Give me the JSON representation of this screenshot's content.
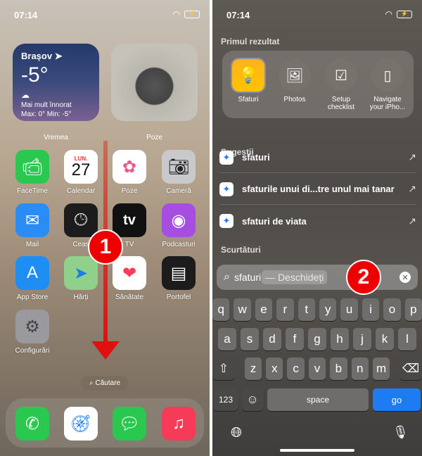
{
  "left": {
    "time": "07:14",
    "weather": {
      "city": "Brașov",
      "temp": "-5°",
      "condition": "Mai mult înnorat",
      "range": "Max: 0° Min: -5°",
      "label": "Vremea"
    },
    "photos_widget": {
      "label": "Poze"
    },
    "apps": [
      {
        "label": "FaceTime",
        "icon": "facetime-icon",
        "color": "#2ac84e"
      },
      {
        "label": "Calendar",
        "icon": "calendar-icon",
        "color": "#ffffff",
        "day": "LUN.",
        "date": "27"
      },
      {
        "label": "Poze",
        "icon": "photos-icon",
        "color": "#ffffff"
      },
      {
        "label": "Cameră",
        "icon": "camera-icon",
        "color": "#c9c9cc"
      },
      {
        "label": "Mail",
        "icon": "mail-icon",
        "color": "#2a8cf5"
      },
      {
        "label": "Ceas",
        "icon": "clock-icon",
        "color": "#1c1c1c"
      },
      {
        "label": "TV",
        "icon": "appletv-icon",
        "color": "#111111",
        "glyph": "tv"
      },
      {
        "label": "Podcasturi",
        "icon": "podcasts-icon",
        "color": "#a64ee0"
      },
      {
        "label": "App Store",
        "icon": "appstore-icon",
        "color": "#1e8ef4"
      },
      {
        "label": "Hărți",
        "icon": "maps-icon",
        "color": "#8fd18b"
      },
      {
        "label": "Sănătate",
        "icon": "health-icon",
        "color": "#ffffff"
      },
      {
        "label": "Portofel",
        "icon": "wallet-icon",
        "color": "#1c1c1c"
      },
      {
        "label": "Configurări",
        "icon": "settings-icon",
        "color": "#9a9a9e"
      }
    ],
    "search_pill": "Căutare",
    "dock": [
      {
        "icon": "phone-icon",
        "color": "#2ac84e"
      },
      {
        "icon": "safari-icon",
        "color": "#ffffff"
      },
      {
        "icon": "messages-icon",
        "color": "#2ac84e"
      },
      {
        "icon": "music-icon",
        "color": "#f53b57"
      }
    ],
    "step_badge": "1"
  },
  "right": {
    "time": "07:14",
    "top_hit_title": "Primul rezultat",
    "top_hits": [
      {
        "label": "Sfaturi",
        "icon": "tips-icon"
      },
      {
        "label": "Photos",
        "icon": "photos-icon"
      },
      {
        "label": "Setup\nchecklist",
        "label1": "Setup",
        "label2": "checklist",
        "icon": "checklist-icon"
      },
      {
        "label1": "Navigate",
        "label2": "your iPho...",
        "icon": "iphone-icon"
      }
    ],
    "suggestions_title": "Sugestii",
    "suggestions": [
      "sfaturi",
      "sfaturile unui di...tre unul mai tanar",
      "sfaturi de viata"
    ],
    "shortcuts_title": "Scurtături",
    "search": {
      "value": "sfaturi",
      "hint": "— Deschideți"
    },
    "step_badge": "2",
    "keyboard": {
      "row1": [
        "q",
        "w",
        "e",
        "r",
        "t",
        "y",
        "u",
        "i",
        "o",
        "p"
      ],
      "row2": [
        "a",
        "s",
        "d",
        "f",
        "g",
        "h",
        "j",
        "k",
        "l"
      ],
      "row3": [
        "z",
        "x",
        "c",
        "v",
        "b",
        "n",
        "m"
      ],
      "numbers": "123",
      "space": "space",
      "go": "go"
    },
    "accent": "#1e7cf2"
  }
}
